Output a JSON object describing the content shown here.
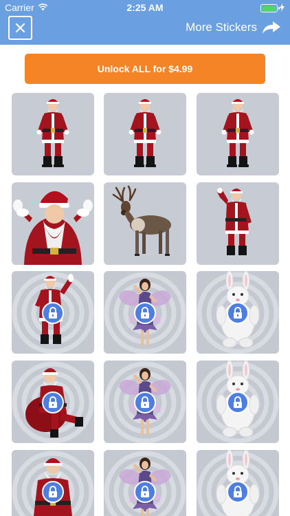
{
  "status_bar": {
    "carrier": "Carrier",
    "time": "2:25 AM"
  },
  "nav": {
    "more_label": "More Stickers",
    "close_icon": "close-icon",
    "share_icon": "share-arrow-icon"
  },
  "unlock": {
    "label": "Unlock ALL for $4.99",
    "color": "#f58426"
  },
  "colors": {
    "header": "#6a9fe2",
    "tile": "#c7cbd3",
    "lock": "#4d7ee0"
  },
  "stickers": [
    {
      "name": "santa-standing-1",
      "locked": false
    },
    {
      "name": "santa-standing-2",
      "locked": false
    },
    {
      "name": "santa-standing-3",
      "locked": false
    },
    {
      "name": "santa-waving-closeup",
      "locked": false
    },
    {
      "name": "reindeer",
      "locked": false
    },
    {
      "name": "santa-saluting",
      "locked": false
    },
    {
      "name": "santa-arms-up",
      "locked": true
    },
    {
      "name": "fairy-1",
      "locked": true
    },
    {
      "name": "bunny-1",
      "locked": true
    },
    {
      "name": "santa-sitting-sack",
      "locked": true
    },
    {
      "name": "fairy-2",
      "locked": true
    },
    {
      "name": "bunny-2",
      "locked": true
    },
    {
      "name": "santa-sitting",
      "locked": true
    },
    {
      "name": "fairy-3",
      "locked": true
    },
    {
      "name": "bunny-3",
      "locked": true
    }
  ]
}
